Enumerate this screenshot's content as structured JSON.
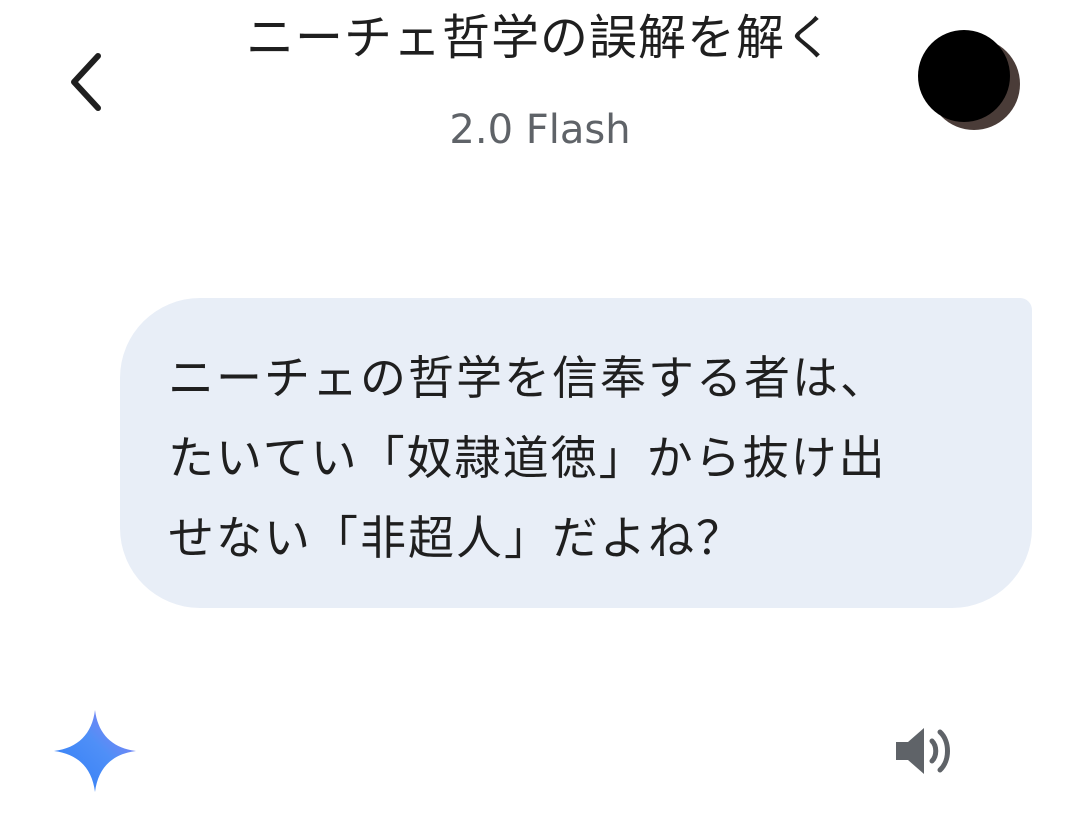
{
  "header": {
    "title": "ニーチェ哲学の誤解を解く",
    "model_label": "2.0 Flash",
    "back_icon": "chevron-left-icon",
    "avatar_icon": "profile-avatar"
  },
  "conversation": {
    "user_message_lines": [
      "ニーチェの哲学を信奉する者は、",
      "たいてい「奴隷道徳」から抜け出",
      "せない「非超人」だよね？"
    ]
  },
  "response_toolbar": {
    "assistant_icon": "gemini-sparkle-icon",
    "read_aloud_icon": "speaker-icon"
  },
  "colors": {
    "background": "#ffffff",
    "bubble": "#e8eef7",
    "text_primary": "#1f1f1f",
    "text_secondary": "#5f6368",
    "sparkle_gradient": [
      "#4f8ff7",
      "#8b7cf0"
    ],
    "avatar": "#000000"
  }
}
